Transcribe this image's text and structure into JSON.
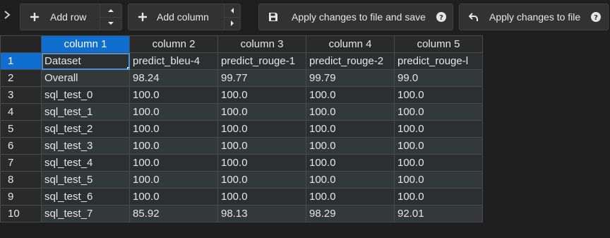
{
  "toolbar": {
    "add_row_label": "Add row",
    "add_column_label": "Add column",
    "apply_save_label": "Apply changes to file and save",
    "apply_label": "Apply changes to file"
  },
  "icons": {
    "expand": "chevron-right-icon",
    "add_row": "plus-icon",
    "add_column": "plus-icon",
    "row_up": "caret-up-icon",
    "row_down": "caret-down-icon",
    "col_left": "caret-left-icon",
    "col_right": "caret-right-icon",
    "save": "save-icon",
    "undo": "undo-arrow-icon",
    "help": "help-circle-icon"
  },
  "colors": {
    "accent": "#0f6fd1",
    "background": "#1f1f1f",
    "cell": "#2b2f30",
    "border": "#4a4a4a"
  },
  "grid": {
    "columns": [
      "column 1",
      "column 2",
      "column 3",
      "column 4",
      "column 5"
    ],
    "rows": [
      {
        "num": "1",
        "cells": [
          "Dataset",
          "predict_bleu-4",
          "predict_rouge-1",
          "predict_rouge-2",
          "predict_rouge-l"
        ]
      },
      {
        "num": "2",
        "cells": [
          "Overall",
          "98.24",
          "99.77",
          "99.79",
          "99.0"
        ]
      },
      {
        "num": "3",
        "cells": [
          "sql_test_0",
          "100.0",
          "100.0",
          "100.0",
          "100.0"
        ]
      },
      {
        "num": "4",
        "cells": [
          "sql_test_1",
          "100.0",
          "100.0",
          "100.0",
          "100.0"
        ]
      },
      {
        "num": "5",
        "cells": [
          "sql_test_2",
          "100.0",
          "100.0",
          "100.0",
          "100.0"
        ]
      },
      {
        "num": "6",
        "cells": [
          "sql_test_3",
          "100.0",
          "100.0",
          "100.0",
          "100.0"
        ]
      },
      {
        "num": "7",
        "cells": [
          "sql_test_4",
          "100.0",
          "100.0",
          "100.0",
          "100.0"
        ]
      },
      {
        "num": "8",
        "cells": [
          "sql_test_5",
          "100.0",
          "100.0",
          "100.0",
          "100.0"
        ]
      },
      {
        "num": "9",
        "cells": [
          "sql_test_6",
          "100.0",
          "100.0",
          "100.0",
          "100.0"
        ]
      },
      {
        "num": "10",
        "cells": [
          "sql_test_7",
          "85.92",
          "98.13",
          "98.29",
          "92.01"
        ]
      }
    ]
  }
}
